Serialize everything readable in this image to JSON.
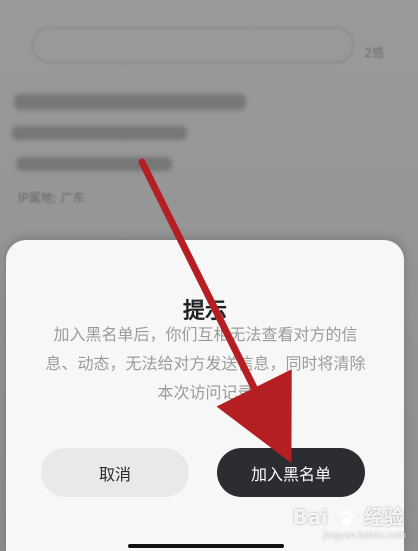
{
  "background": {
    "badge": "2感",
    "location": "IP属地: 广东"
  },
  "dialog": {
    "title": "提示",
    "message": "加入黑名单后，你们互相无法查看对方的信息、动态，无法给对方发送信息，同时将清除本次访问记录",
    "cancel_label": "取消",
    "confirm_label": "加入黑名单"
  },
  "watermark": {
    "brand_left": "Bai",
    "brand_right": "经验",
    "site": "jingyan.baidu.com"
  },
  "colors": {
    "dialog_bg": "#f7f7f8",
    "cancel_bg": "#e8e9eb",
    "confirm_bg": "#2b2d31",
    "arrow": "#b51f24"
  }
}
